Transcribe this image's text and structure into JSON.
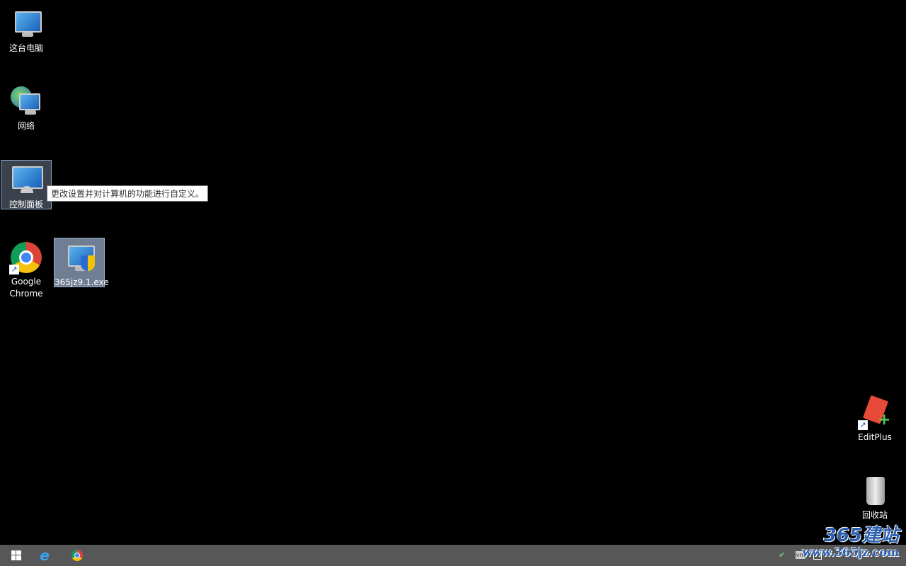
{
  "desktop": {
    "icons": [
      {
        "label": "这台电脑",
        "icon": "computer-icon"
      },
      {
        "label": "网络",
        "icon": "network-icon"
      },
      {
        "label": "控制面板",
        "icon": "control-panel-icon"
      },
      {
        "label": "Google Chrome",
        "icon": "chrome-icon"
      },
      {
        "label": "365jz9.1.exe",
        "icon": "installer-icon"
      },
      {
        "label": "EditPlus",
        "icon": "editplus-icon"
      },
      {
        "label": "回收站",
        "icon": "recycle-bin-icon"
      }
    ],
    "tooltip": "更改设置并对计算机的功能进行自定义。"
  },
  "taskbar": {
    "items": [
      "start-button",
      "internet-explorer",
      "google-chrome"
    ],
    "tray": [
      "network-ok-icon",
      "vmware-icon",
      "network-icon"
    ]
  },
  "watermark": {
    "brand": "365建站",
    "url": "www.365jz.com"
  },
  "colors": {
    "taskbar": "#575757",
    "desktop": "#000000"
  }
}
